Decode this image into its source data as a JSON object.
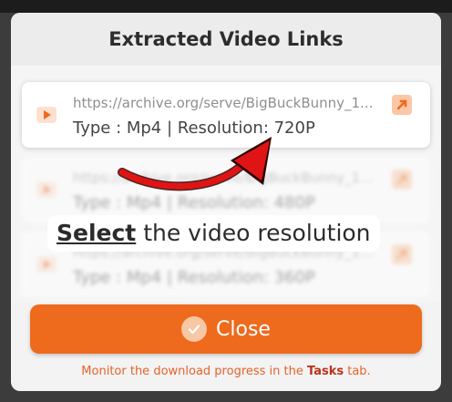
{
  "dialog": {
    "title": "Extracted Video Links",
    "items": [
      {
        "url": "https://archive.org/serve/BigBuckBunny_1...",
        "details": "Type : Mp4 | Resolution: 720P"
      },
      {
        "url": "https://archive.org/serve/BigBuckBunny_1...",
        "details": "Type : Mp4 | Resolution: 480P"
      },
      {
        "url": "https://archive.org/serve/BigBuckBunny_1...",
        "details": "Type : Mp4 | Resolution: 360P"
      }
    ],
    "callout": {
      "bold": "Select",
      "rest": " the video resolution"
    },
    "close_label": "Close",
    "footnote": {
      "prefix": "Monitor the download progress in the ",
      "link": "Tasks",
      "suffix": " tab."
    }
  },
  "icons": {
    "item": "video-play-icon",
    "open": "open-external-icon",
    "close": "check-circle-icon",
    "pointer": "curved-arrow-icon"
  },
  "colors": {
    "accent": "#ee6a1d",
    "arrow": "#e01414",
    "tasks_link": "#b9331b"
  }
}
